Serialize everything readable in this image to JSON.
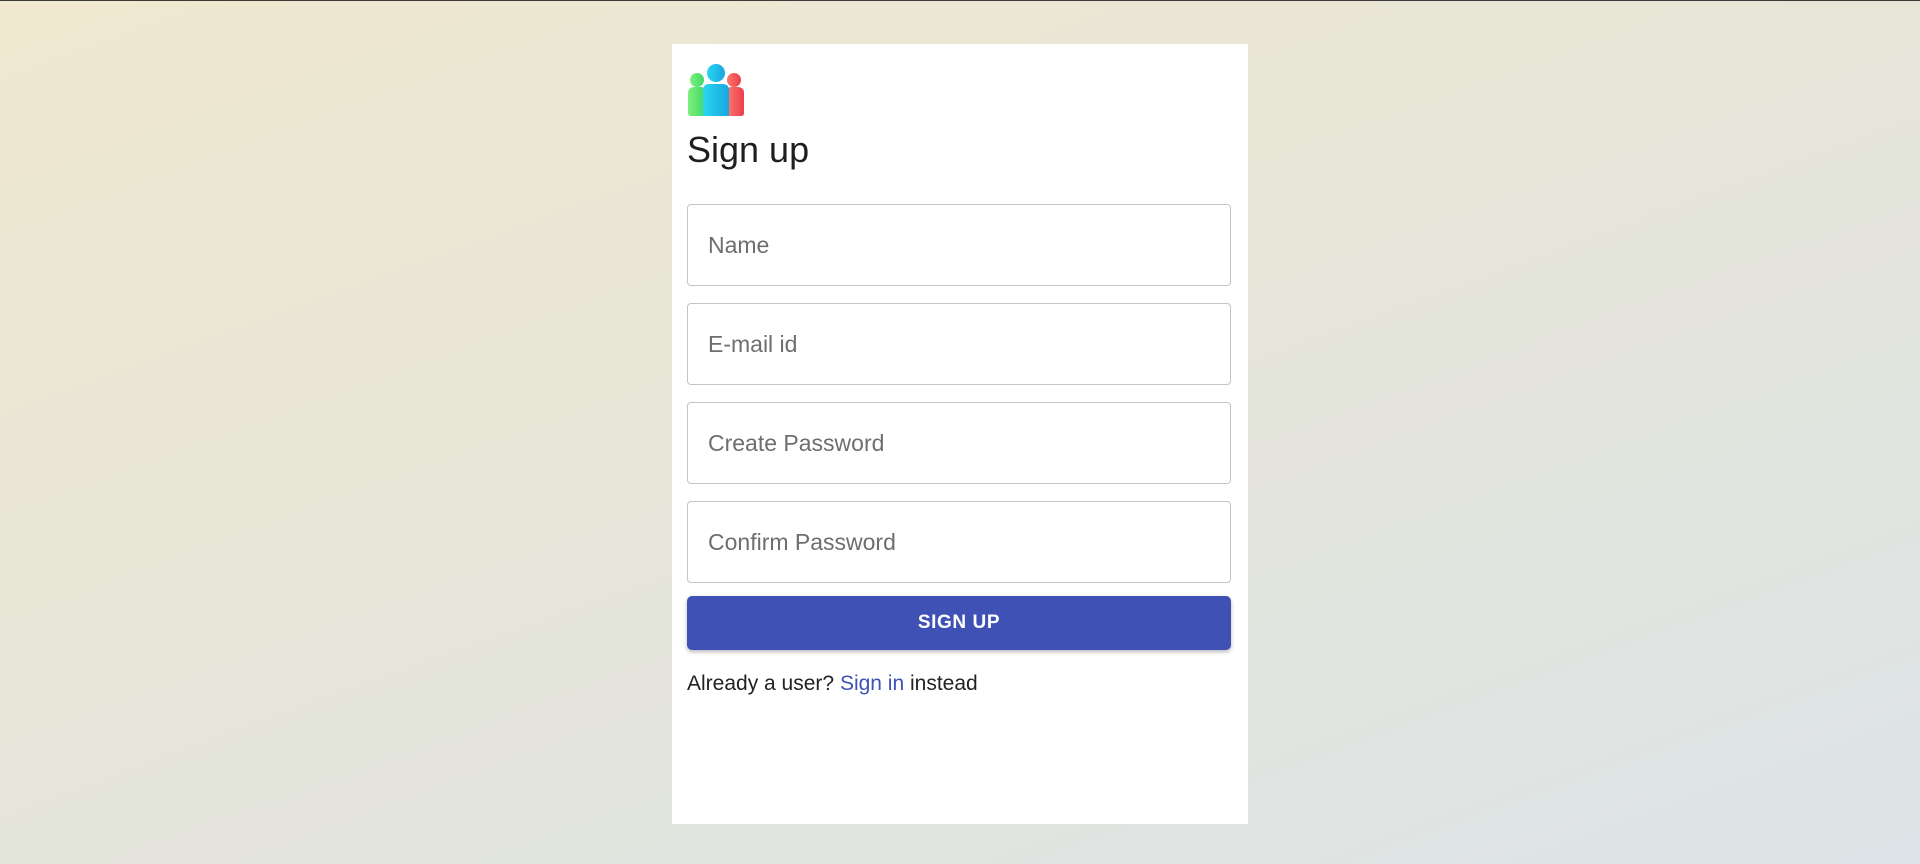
{
  "signup": {
    "title": "Sign up",
    "logo_icon": "users-group-icon",
    "fields": {
      "name": {
        "placeholder": "Name",
        "value": ""
      },
      "email": {
        "placeholder": "E-mail id",
        "value": ""
      },
      "create_password": {
        "placeholder": "Create Password",
        "value": ""
      },
      "confirm_password": {
        "placeholder": "Confirm Password",
        "value": ""
      }
    },
    "submit_label": "SIGN UP",
    "footer": {
      "prefix": "Already a user?",
      "link": "Sign in",
      "suffix": "instead"
    }
  },
  "colors": {
    "primary": "#3f51b5",
    "card_bg": "#ffffff",
    "bg_start": "#f0e9d0",
    "bg_end": "#dde3e7",
    "logo_green": "#5ee07a",
    "logo_blue": "#1ec8e8",
    "logo_red": "#f0555a"
  }
}
